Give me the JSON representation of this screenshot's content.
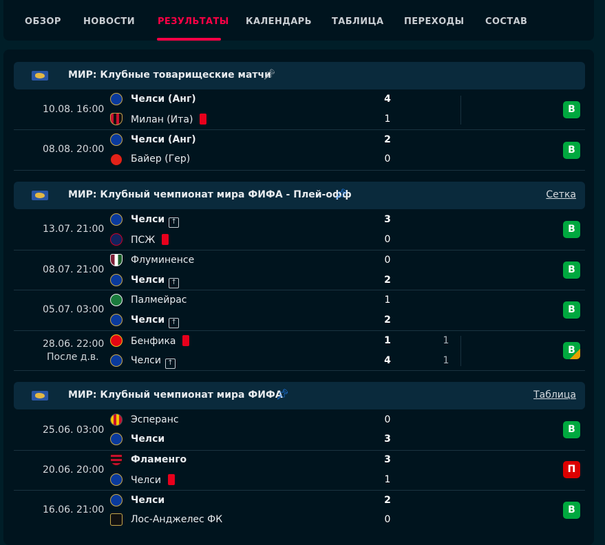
{
  "nav": {
    "tabs": [
      {
        "label": "ОБЗОР"
      },
      {
        "label": "НОВОСТИ"
      },
      {
        "label": "РЕЗУЛЬТАТЫ",
        "active": true
      },
      {
        "label": "КАЛЕНДАРЬ"
      },
      {
        "label": "ТАБЛИЦА"
      },
      {
        "label": "ПЕРЕХОДЫ"
      },
      {
        "label": "СОСТАВ"
      }
    ]
  },
  "colors": {
    "accent": "#ff0046",
    "win": "#00a83f",
    "loss": "#dc0000",
    "red_card": "#e8001c",
    "background": "#001e28"
  },
  "sections": [
    {
      "title": "МИР: Клубные товарищеские матчи",
      "pin_icon": "pin-outline-icon",
      "link": "",
      "matches": [
        {
          "time": "10.08. 16:00",
          "home": {
            "name": "Челси (Анг)",
            "bold": true,
            "score": "4",
            "logo": "chelsea-logo"
          },
          "away": {
            "name": "Милан (Ита)",
            "bold": false,
            "score": "1",
            "red_card": true,
            "logo": "milan-logo"
          },
          "result": "В"
        },
        {
          "time": "08.08. 20:00",
          "home": {
            "name": "Челси (Анг)",
            "bold": true,
            "score": "2",
            "logo": "chelsea-logo"
          },
          "away": {
            "name": "Байер (Гер)",
            "bold": false,
            "score": "0",
            "logo": "bayer-logo"
          },
          "result": "В"
        }
      ]
    },
    {
      "title": "МИР: Клубный чемпионат мира ФИФА - Плей-офф",
      "pin_icon": "pin-filled-icon",
      "link": "Сетка",
      "matches": [
        {
          "time": "13.07. 21:00",
          "home": {
            "name": "Челси",
            "bold": true,
            "score": "3",
            "advance": true,
            "logo": "chelsea-logo"
          },
          "away": {
            "name": "ПСЖ",
            "bold": false,
            "score": "0",
            "red_card": true,
            "logo": "psg-logo"
          },
          "result": "В"
        },
        {
          "time": "08.07. 21:00",
          "home": {
            "name": "Флуминенсе",
            "bold": false,
            "score": "0",
            "logo": "fluminense-logo"
          },
          "away": {
            "name": "Челси",
            "bold": true,
            "score": "2",
            "advance": true,
            "logo": "chelsea-logo"
          },
          "result": "В"
        },
        {
          "time": "05.07. 03:00",
          "home": {
            "name": "Палмейрас",
            "bold": false,
            "score": "1",
            "logo": "palmeiras-logo"
          },
          "away": {
            "name": "Челси",
            "bold": true,
            "score": "2",
            "advance": true,
            "logo": "chelsea-logo"
          },
          "result": "В"
        },
        {
          "time": "28.06. 22:00",
          "note": "После д.в.",
          "home": {
            "name": "Бенфика",
            "bold": false,
            "score": "1",
            "extra": "1",
            "red_card": true,
            "logo": "benfica-logo"
          },
          "away": {
            "name": "Челси",
            "bold": false,
            "score": "4",
            "extra": "1",
            "advance": true,
            "logo": "chelsea-logo"
          },
          "result": "В"
        }
      ]
    },
    {
      "title": "МИР: Клубный чемпионат мира ФИФА",
      "pin_icon": "pin-filled-icon",
      "link": "Таблица",
      "matches": [
        {
          "time": "25.06. 03:00",
          "home": {
            "name": "Эсперанс",
            "bold": false,
            "score": "0",
            "logo": "esperance-logo"
          },
          "away": {
            "name": "Челси",
            "bold": true,
            "score": "3",
            "logo": "chelsea-logo"
          },
          "result": "В"
        },
        {
          "time": "20.06. 20:00",
          "home": {
            "name": "Фламенго",
            "bold": true,
            "score": "3",
            "logo": "flamengo-logo"
          },
          "away": {
            "name": "Челси",
            "bold": false,
            "score": "1",
            "red_card": true,
            "logo": "chelsea-logo"
          },
          "result": "П"
        },
        {
          "time": "16.06. 21:00",
          "home": {
            "name": "Челси",
            "bold": true,
            "score": "2",
            "logo": "chelsea-logo"
          },
          "away": {
            "name": "Лос-Анджелес ФК",
            "bold": false,
            "score": "0",
            "logo": "lafc-logo"
          },
          "result": "В"
        }
      ]
    }
  ]
}
